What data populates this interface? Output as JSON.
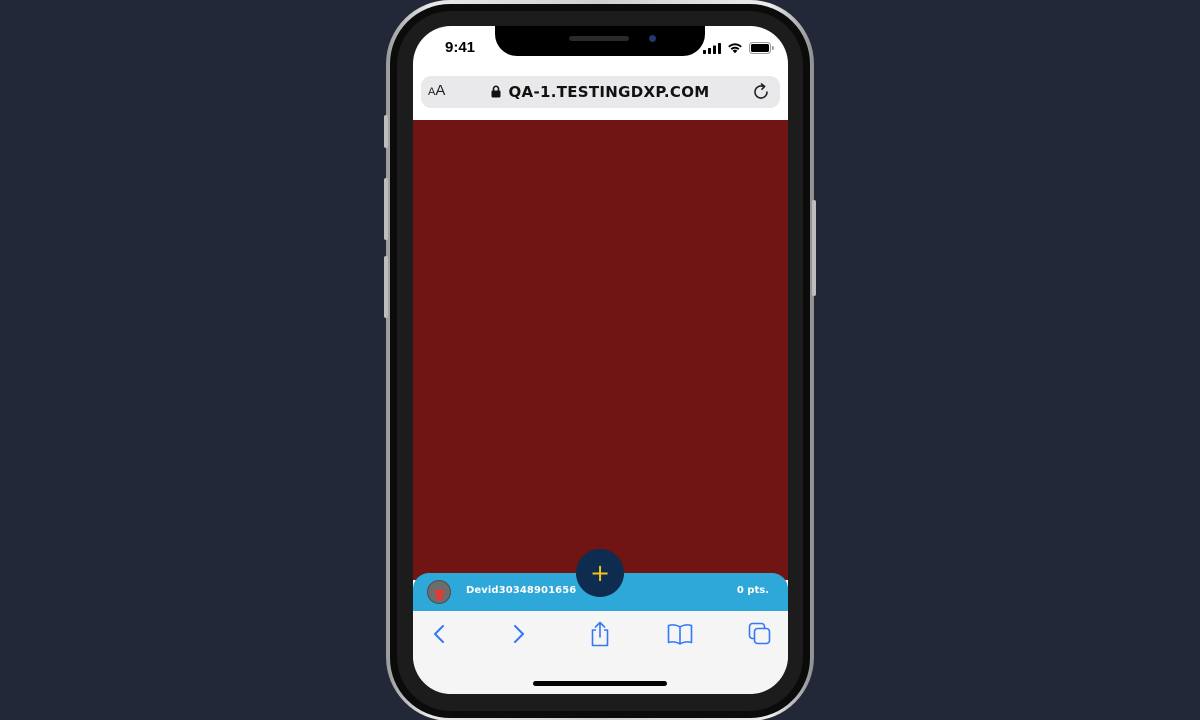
{
  "status_bar": {
    "time": "9:41"
  },
  "browser": {
    "text_size_label_small": "A",
    "text_size_label_large": "A",
    "url": "QA-1.TESTINGDXP.COM"
  },
  "app_bar": {
    "username": "Devid30348901656",
    "points": "0 pts.",
    "fab_label": "+"
  },
  "colors": {
    "page_background": "#222837",
    "content_background": "#701414",
    "app_bar": "#2ea7d9",
    "fab": "#0d2c4f",
    "fab_icon": "#f0c419",
    "toolbar_icon": "#3478f6"
  },
  "icons": {
    "lock": "lock-icon",
    "reload": "reload-icon",
    "back": "chevron-left-icon",
    "forward": "chevron-right-icon",
    "share": "share-icon",
    "bookmarks": "book-icon",
    "tabs": "tabs-icon",
    "signal": "cellular-signal-icon",
    "wifi": "wifi-icon",
    "battery": "battery-icon",
    "avatar": "shirt-icon"
  }
}
